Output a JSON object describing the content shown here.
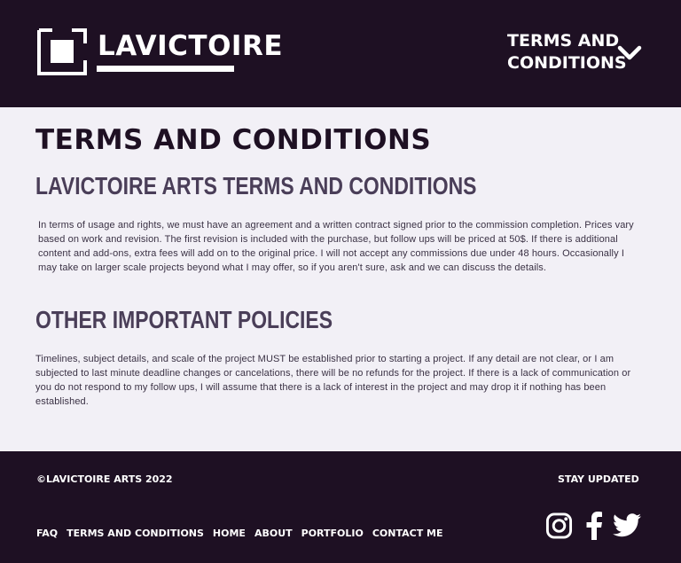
{
  "header": {
    "logo_text": "LAVICTOIRE",
    "nav_menu_line1": "TERMS AND",
    "nav_menu_line2": "CONDITIONS"
  },
  "main": {
    "page_title": "TERMS AND CONDITIONS",
    "section1": {
      "heading": "LAVICTOIRE ARTS TERMS AND CONDITIONS",
      "body": "In terms of usage and rights, we must have an agreement and a written contract signed prior to the commission completion. Prices vary based on work and revision. The first revision is included with the purchase, but follow ups will be priced at 50$. If there is additional content and add-ons, extra fees will add on to the original price. I will not accept any commissions due under 48 hours. Occasionally I may take on larger scale projects beyond what I may offer, so if you aren't sure, ask and we can discuss the details."
    },
    "section2": {
      "heading": "OTHER IMPORTANT POLICIES",
      "body": "Timelines,  subject details, and scale of the project MUST be established prior to starting a project. If any detail are not clear, or I am subjected to last minute deadline changes or cancelations, there will be no refunds for the project. If there is a lack of communication or you do not respond to my follow ups, I will assume that there is a lack of interest in the project and may drop it if nothing has been established."
    }
  },
  "footer": {
    "copyright": "©LAVICTOIRE ARTS 2022",
    "stay_updated": "STAY UPDATED",
    "links": [
      "FAQ",
      "TERMS AND CONDITIONS",
      "HOME",
      "ABOUT",
      "PORTFOLIO",
      "CONTACT ME"
    ],
    "social_icons": [
      "instagram-icon",
      "facebook-icon",
      "twitter-icon"
    ]
  },
  "colors": {
    "header_bg": "#1e1023",
    "page_bg": "#f2f0f6",
    "heading": "#4a3e58",
    "text": "#3a3144"
  }
}
